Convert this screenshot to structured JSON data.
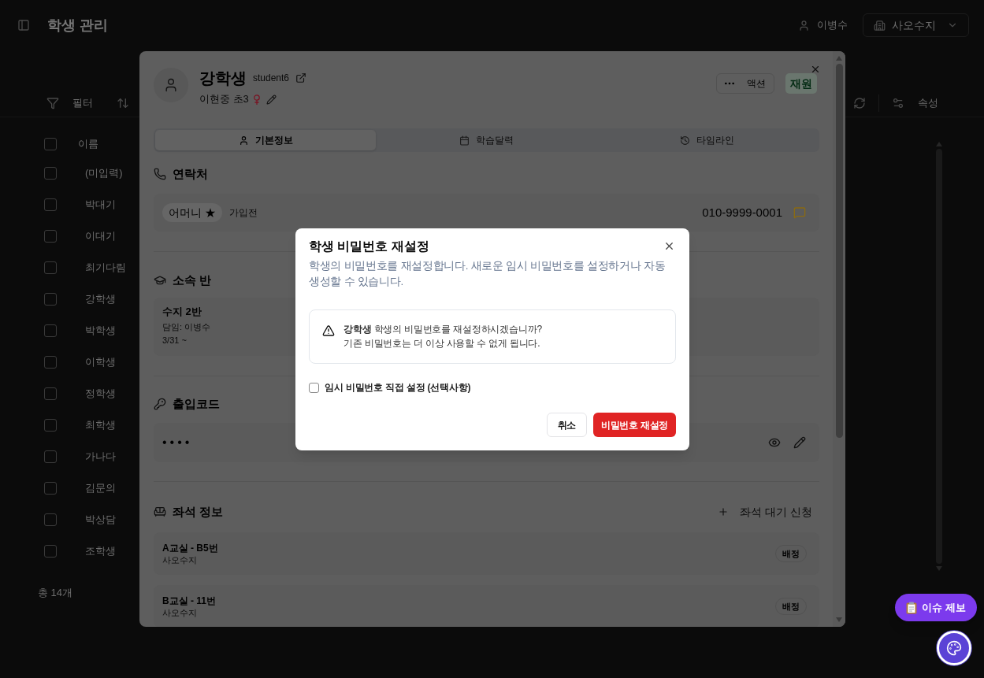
{
  "page": {
    "title": "학생 관리",
    "user": "이병수",
    "branch": "사오수지",
    "toolbar": {
      "filter": "필터",
      "properties": "속성"
    },
    "list": {
      "header": {
        "label": "이름",
        "checked": false
      },
      "rows": [
        {
          "name": "(미입력)",
          "checked": false
        },
        {
          "name": "박대기",
          "checked": false
        },
        {
          "name": "이대기",
          "checked": false
        },
        {
          "name": "최기다림",
          "checked": false
        },
        {
          "name": "강학생",
          "checked": false
        },
        {
          "name": "박학생",
          "checked": false
        },
        {
          "name": "이학생",
          "checked": false
        },
        {
          "name": "정학생",
          "checked": false
        },
        {
          "name": "최학생",
          "checked": false
        },
        {
          "name": "가나다",
          "checked": false
        },
        {
          "name": "김문의",
          "checked": false
        },
        {
          "name": "박상담",
          "checked": false
        },
        {
          "name": "조학생",
          "checked": false
        }
      ],
      "total": "총 14개"
    }
  },
  "student_panel": {
    "name": "강학생",
    "username": "student6",
    "school": "이현중 초3",
    "action_button": "액션",
    "status": "재원",
    "tabs": [
      {
        "label": "기본정보",
        "selected": true
      },
      {
        "label": "학습달력",
        "selected": false
      },
      {
        "label": "타임라인",
        "selected": false
      }
    ],
    "contacts": {
      "title": "연락처",
      "items": [
        {
          "relation": "어머니 ★",
          "status": "가입전",
          "phone": "010-9999-0001"
        }
      ]
    },
    "class": {
      "title": "소속 반",
      "items": [
        {
          "name": "수지 2반",
          "teacher": "담임: 이병수",
          "period": "3/31 ~"
        }
      ]
    },
    "access_code": {
      "title": "출입코드",
      "value": "••••"
    },
    "seats": {
      "title": "좌석 정보",
      "action": "좌석 대기 신청",
      "items": [
        {
          "seat": "A교실 - B5번",
          "branch": "사오수지",
          "status": "배정"
        },
        {
          "seat": "B교실 - 11번",
          "branch": "사오수지",
          "status": "배정"
        }
      ]
    }
  },
  "dialog": {
    "title": "학생 비밀번호 재설정",
    "description": "학생의 비밀번호를 재설정합니다. 새로운 임시 비밀번호를 설정하거나 자동 생성할 수 있습니다.",
    "warning": {
      "message": "**강학생** 학생의 비밀번호를 재설정하시겠습니까?",
      "detail": "기존 비밀번호는 더 이상 사용할 수 없게 됩니다."
    },
    "option": {
      "label": "임시 비밀번호 직접 설정 (선택사항)",
      "checked": false
    },
    "buttons": [
      {
        "label": "취소",
        "kind": "secondary"
      },
      {
        "label": "비밀번호 재설정",
        "kind": "danger"
      }
    ]
  },
  "report_button": "이슈 제보"
}
